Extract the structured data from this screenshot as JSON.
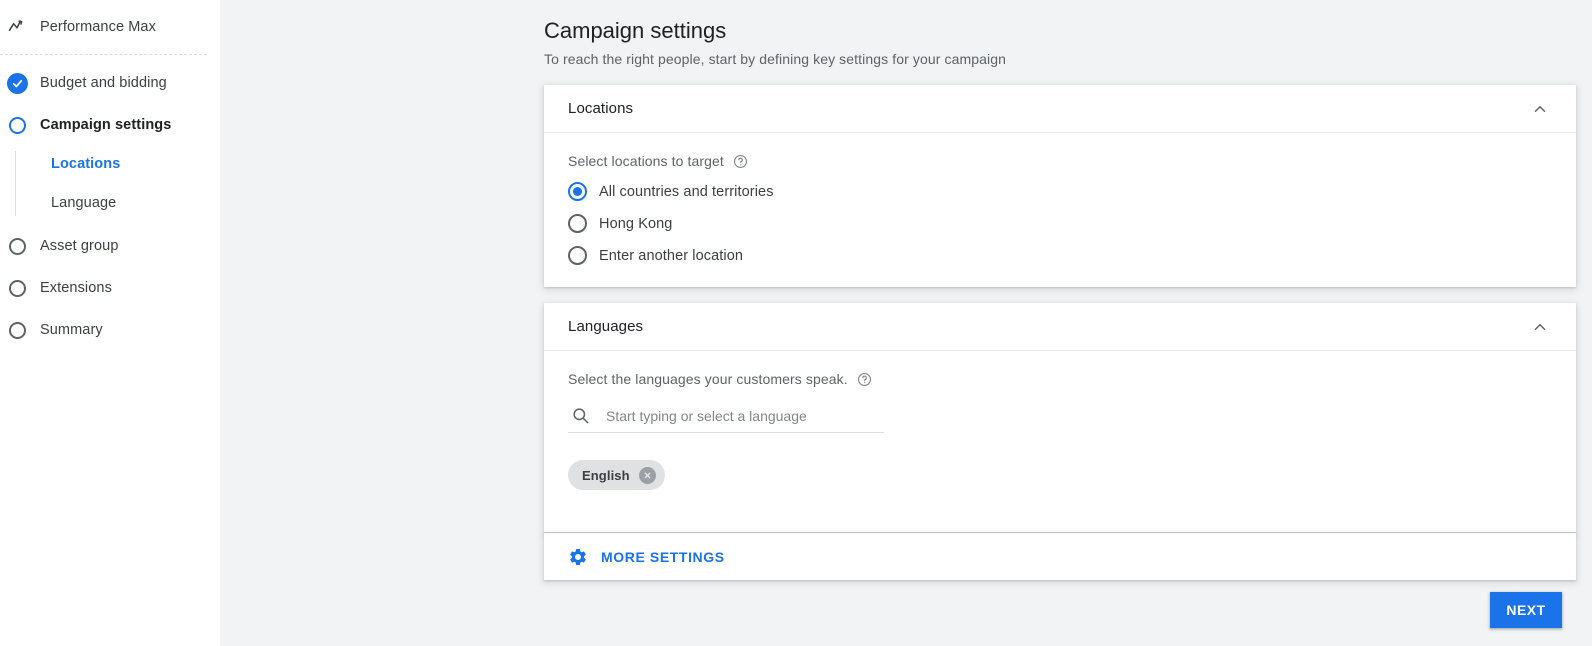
{
  "sidebar": {
    "items": [
      {
        "label": "Performance Max",
        "icon": "trend-icon",
        "state": "current-campaign"
      },
      {
        "label": "Budget and bidding",
        "icon": "check-circle-icon",
        "state": "complete"
      },
      {
        "label": "Campaign settings",
        "icon": "radio-circle-icon",
        "state": "active"
      },
      {
        "label": "Asset group",
        "icon": "radio-circle-icon",
        "state": "pending"
      },
      {
        "label": "Extensions",
        "icon": "radio-circle-icon",
        "state": "pending"
      },
      {
        "label": "Summary",
        "icon": "radio-circle-icon",
        "state": "pending"
      }
    ],
    "sub_items": [
      {
        "label": "Locations",
        "state": "active"
      },
      {
        "label": "Language",
        "state": "inactive"
      }
    ]
  },
  "header": {
    "title": "Campaign settings",
    "subtitle": "To reach the right people, start by defining key settings for your campaign"
  },
  "locations_card": {
    "title": "Locations",
    "collapse_icon": "chevron-up-icon",
    "field_label": "Select locations to target",
    "help_icon": "help-circle-icon",
    "options": [
      {
        "label": "All countries and territories",
        "selected": true
      },
      {
        "label": "Hong Kong",
        "selected": false
      },
      {
        "label": "Enter another location",
        "selected": false
      }
    ]
  },
  "languages_card": {
    "title": "Languages",
    "collapse_icon": "chevron-up-icon",
    "field_label": "Select the languages your customers speak.",
    "help_icon": "help-circle-icon",
    "search": {
      "icon": "search-icon",
      "value": "",
      "placeholder": "Start typing or select a language"
    },
    "chips": [
      {
        "label": "English",
        "remove_icon": "close-circle-icon"
      }
    ]
  },
  "more_settings": {
    "icon": "gear-icon",
    "label": "MORE SETTINGS"
  },
  "footer": {
    "next_label": "NEXT"
  },
  "colors": {
    "accent": "#1a73e8",
    "page_background": "#f1f3f4",
    "card_background": "#ffffff",
    "text_primary": "#202124",
    "text_secondary": "#5f6368",
    "chip_background": "#dfe1e3"
  }
}
